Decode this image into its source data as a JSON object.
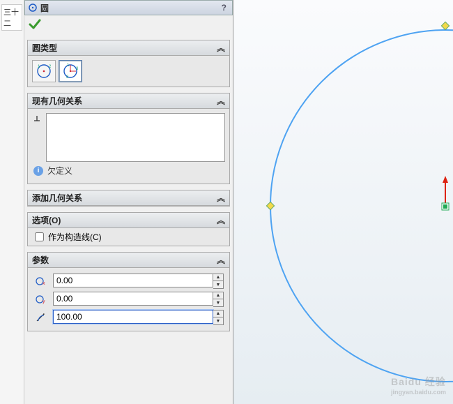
{
  "left_tab": "三十二",
  "header": {
    "title": "圆",
    "help": "?"
  },
  "sections": {
    "type": {
      "title": "圆类型"
    },
    "existing_relations": {
      "title": "现有几何关系",
      "status": "欠定义"
    },
    "add_relations": {
      "title": "添加几何关系"
    },
    "options": {
      "title": "选项(O)",
      "construction_label": "作为构造线(C)"
    },
    "params": {
      "title": "参数",
      "cx": "0.00",
      "cy": "0.00",
      "radius": "100.00"
    }
  },
  "watermark": {
    "line1": "Baidu 经验",
    "line2": "jingyan.baidu.com"
  }
}
